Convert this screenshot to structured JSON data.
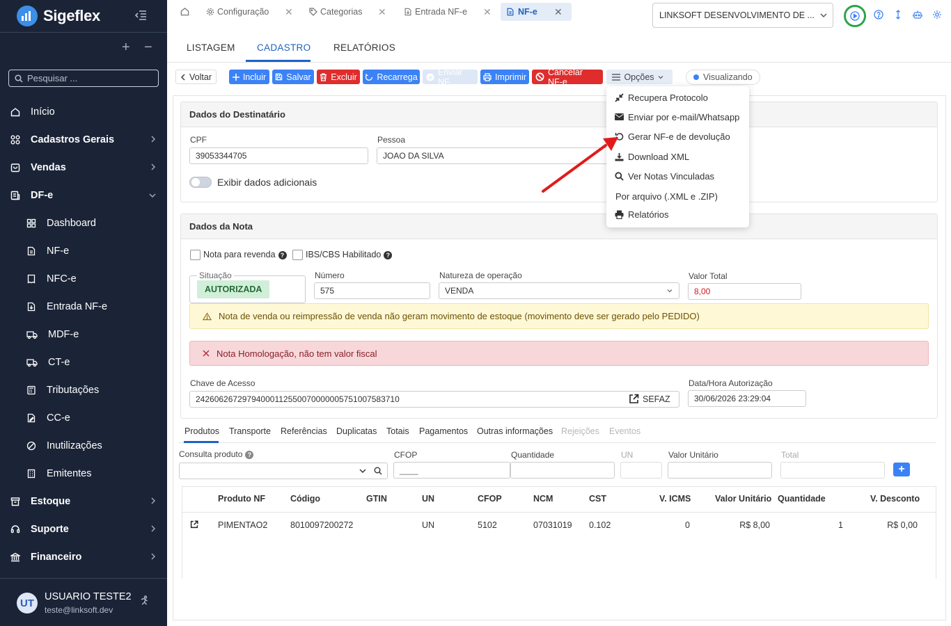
{
  "app": {
    "name": "Sigeflex",
    "search_placeholder": "Pesquisar ...",
    "plus": "+",
    "minus": "−"
  },
  "sidebar": {
    "items": [
      {
        "label": "Início",
        "icon": "home-icon",
        "level": "top",
        "bold": false
      },
      {
        "label": "Cadastros Gerais",
        "icon": "grid-icon",
        "level": "top",
        "bold": true,
        "chevron": "right"
      },
      {
        "label": "Vendas",
        "icon": "bag-icon",
        "level": "top",
        "bold": true,
        "chevron": "right"
      },
      {
        "label": "DF-e",
        "icon": "document-icon",
        "level": "top",
        "bold": true,
        "chevron": "down"
      },
      {
        "label": "Dashboard",
        "icon": "dashboard-icon",
        "level": "sub"
      },
      {
        "label": "NF-e",
        "icon": "file-icon",
        "level": "sub"
      },
      {
        "label": "NFC-e",
        "icon": "receipt-icon",
        "level": "sub"
      },
      {
        "label": "Entrada NF-e",
        "icon": "file-import-icon",
        "level": "sub"
      },
      {
        "label": "MDF-e",
        "icon": "truck-icon",
        "level": "sub"
      },
      {
        "label": "CT-e",
        "icon": "truck-icon",
        "level": "sub"
      },
      {
        "label": "Tributações",
        "icon": "calculator-icon",
        "level": "sub"
      },
      {
        "label": "CC-e",
        "icon": "edit-file-icon",
        "level": "sub"
      },
      {
        "label": "Inutilizações",
        "icon": "ban-icon",
        "level": "sub"
      },
      {
        "label": "Emitentes",
        "icon": "building-icon",
        "level": "sub"
      },
      {
        "label": "Estoque",
        "icon": "box-icon",
        "level": "top",
        "bold": true,
        "chevron": "right"
      },
      {
        "label": "Suporte",
        "icon": "headset-icon",
        "level": "top",
        "bold": true,
        "chevron": "right"
      },
      {
        "label": "Financeiro",
        "icon": "bank-icon",
        "level": "top",
        "bold": true,
        "chevron": "right"
      }
    ]
  },
  "user": {
    "initials": "UT",
    "name": "USUARIO TESTE2",
    "email": "teste@linksoft.dev"
  },
  "top_tabs": [
    {
      "label": "Configuração",
      "icon": "gear-icon"
    },
    {
      "label": "Categorias",
      "icon": "tag-icon"
    },
    {
      "label": "Entrada NF-e",
      "icon": "file-import-icon"
    },
    {
      "label": "NF-e",
      "icon": "file-icon",
      "active": true
    }
  ],
  "company": {
    "selected": "LINKSOFT DESENVOLVIMENTO DE ..."
  },
  "main_tabs": [
    "LISTAGEM",
    "CADASTRO",
    "RELATÓRIOS"
  ],
  "toolbar": {
    "back": "Voltar",
    "include": "Incluir",
    "save": "Salvar",
    "delete": "Excluir",
    "reload": "Recarrega",
    "send": "Enviar NF",
    "print": "Imprimir",
    "cancel": "Cancelar NF-e",
    "options": "Opções",
    "status": "Visualizando"
  },
  "options_menu": [
    {
      "label": "Recupera Protocolo",
      "icon": "compress-icon"
    },
    {
      "label": "Enviar por e-mail/Whatsapp",
      "icon": "envelope-icon"
    },
    {
      "label": "Gerar NF-e de devolução",
      "icon": "undo-icon"
    },
    {
      "label": "Download XML",
      "icon": "download-icon"
    },
    {
      "label": "Ver Notas Vinculadas",
      "icon": "search-icon"
    },
    {
      "label": "Por arquivo (.XML e .ZIP)",
      "icon": ""
    },
    {
      "label": "Relatórios",
      "icon": "print-icon"
    }
  ],
  "destinatario": {
    "title": "Dados do Destinatário",
    "cpf_label": "CPF",
    "cpf": "39053344705",
    "pessoa_label": "Pessoa",
    "pessoa": "JOAO DA SILVA",
    "toggle_label": "Exibir dados adicionais"
  },
  "nota": {
    "title": "Dados da Nota",
    "revenda_label": "Nota para revenda",
    "ibs_label": "IBS/CBS Habilitado",
    "help": "?",
    "situacao_label": "Situação",
    "situacao": "AUTORIZADA",
    "numero_label": "Número",
    "numero": "575",
    "natureza_label": "Natureza de operação",
    "natureza": "VENDA",
    "valor_label": "Valor Total",
    "valor": "8,00",
    "warning": "Nota de venda ou reimpressão de venda não geram movimento de estoque (movimento deve ser gerado pelo PEDIDO)",
    "error": "Nota Homologação, não tem valor fiscal",
    "chave_label": "Chave de Acesso",
    "chave": "24260626729794000112550070000005751007583710",
    "sefaz": "SEFAZ",
    "datahora_label": "Data/Hora Autorização",
    "datahora": "30/06/2026 23:29:04"
  },
  "bottom_tabs": [
    {
      "label": "Produtos",
      "active": true
    },
    {
      "label": "Transporte"
    },
    {
      "label": "Referências"
    },
    {
      "label": "Duplicatas"
    },
    {
      "label": "Totais"
    },
    {
      "label": "Pagamentos"
    },
    {
      "label": "Outras informações"
    },
    {
      "label": "Rejeições",
      "disabled": true
    },
    {
      "label": "Eventos",
      "disabled": true
    }
  ],
  "product_form": {
    "consulta_label": "Consulta produto",
    "cfop_label": "CFOP",
    "cfop_placeholder": "____",
    "quantidade_label": "Quantidade",
    "un_label": "UN",
    "valor_unit_label": "Valor Unitário",
    "total_label": "Total",
    "add": "+"
  },
  "products_table": {
    "headers": [
      "Produto NF",
      "Código",
      "GTIN",
      "UN",
      "CFOP",
      "NCM",
      "CST",
      "V. ICMS",
      "Valor Unitário",
      "Quantidade",
      "V. Desconto"
    ],
    "rows": [
      [
        "PIMENTAO2",
        "8010097200272",
        "",
        "UN",
        "5102",
        "07031019",
        "0.102",
        "0",
        "R$ 8,00",
        "1",
        "R$ 0,00"
      ]
    ]
  },
  "colors": {
    "sidebar": "#1b2437",
    "primary": "#3b82f6",
    "danger": "#df2d2d",
    "success_bg": "#d1efd8",
    "warning_bg": "#fef8d7",
    "error_bg": "#f8d7da",
    "arrow": "#e11b1b"
  }
}
